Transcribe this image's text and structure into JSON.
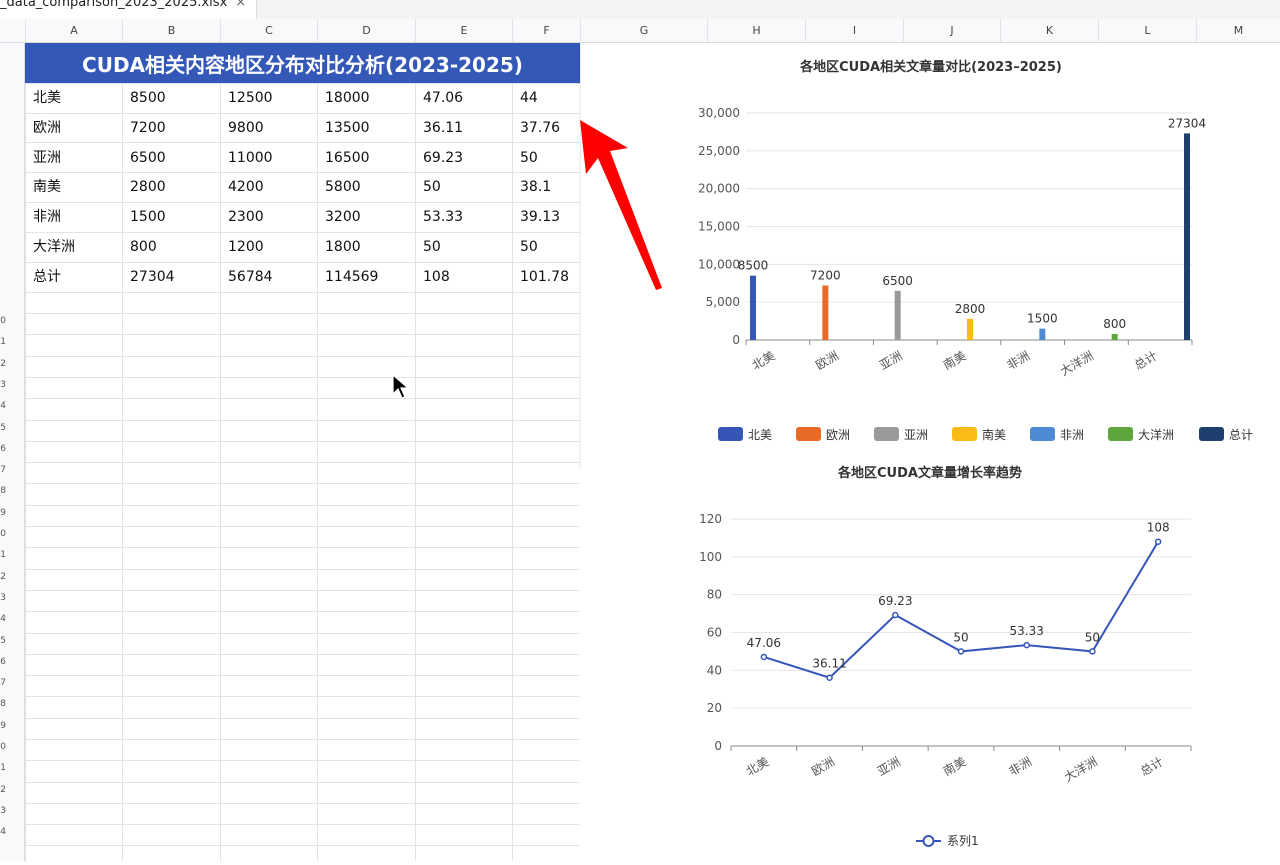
{
  "tab": {
    "title": "_data_comparison_2023_2025.xlsx",
    "close": "×"
  },
  "columns": [
    "A",
    "B",
    "C",
    "D",
    "E",
    "F",
    "G",
    "H",
    "I",
    "J",
    "K",
    "L",
    "M"
  ],
  "row_numbers": [
    "0",
    "1",
    "2",
    "3",
    "4",
    "5",
    "6",
    "7",
    "8",
    "9",
    "0",
    "1",
    "2",
    "3",
    "4",
    "5",
    "6",
    "7",
    "8",
    "9",
    "0",
    "1",
    "2",
    "3",
    "4"
  ],
  "sheet": {
    "title": "CUDA相关内容地区分布对比分析(2023-2025)",
    "rows": [
      [
        "北美",
        "8500",
        "12500",
        "18000",
        "47.06",
        "44"
      ],
      [
        "欧洲",
        "7200",
        "9800",
        "13500",
        "36.11",
        "37.76"
      ],
      [
        "亚洲",
        "6500",
        "11000",
        "16500",
        "69.23",
        "50"
      ],
      [
        "南美",
        "2800",
        "4200",
        "5800",
        "50",
        "38.1"
      ],
      [
        "非洲",
        "1500",
        "2300",
        "3200",
        "53.33",
        "39.13"
      ],
      [
        "大洋洲",
        "800",
        "1200",
        "1800",
        "50",
        "50"
      ],
      [
        "总计",
        "27304",
        "56784",
        "114569",
        "108",
        "101.78"
      ]
    ]
  },
  "colors": {
    "header_blue": "#3358b8",
    "arrow_red": "#ff0000"
  },
  "chart_data": [
    {
      "type": "bar",
      "title": "各地区CUDA相关文章量对比(2023–2025)",
      "categories": [
        "北美",
        "欧洲",
        "亚洲",
        "南美",
        "非洲",
        "大洋洲",
        "总计"
      ],
      "series": [
        {
          "name": "北美",
          "values": [
            8500,
            null,
            null,
            null,
            null,
            null,
            null
          ],
          "color": "#3556b8"
        },
        {
          "name": "欧洲",
          "values": [
            null,
            7200,
            null,
            null,
            null,
            null,
            null
          ],
          "color": "#e86a24"
        },
        {
          "name": "亚洲",
          "values": [
            null,
            null,
            6500,
            null,
            null,
            null,
            null
          ],
          "color": "#9a9a9a"
        },
        {
          "name": "南美",
          "values": [
            null,
            null,
            null,
            2800,
            null,
            null,
            null
          ],
          "color": "#fbbb16"
        },
        {
          "name": "非洲",
          "values": [
            null,
            null,
            null,
            null,
            1500,
            null,
            null
          ],
          "color": "#4d8ad3"
        },
        {
          "name": "大洋洲",
          "values": [
            null,
            null,
            null,
            null,
            null,
            800,
            null
          ],
          "color": "#5ea53c"
        },
        {
          "name": "总计",
          "values": [
            null,
            null,
            null,
            null,
            null,
            null,
            27304
          ],
          "color": "#1f3f6f"
        }
      ],
      "yticks": [
        "0",
        "5,000",
        "10,000",
        "15,000",
        "20,000",
        "25,000",
        "30,000"
      ],
      "ylim": [
        0,
        30000
      ],
      "legend": "bottom"
    },
    {
      "type": "line",
      "title": "各地区CUDA文章量增长率趋势",
      "categories": [
        "北美",
        "欧洲",
        "亚洲",
        "南美",
        "非洲",
        "大洋洲",
        "总计"
      ],
      "series": [
        {
          "name": "系列1",
          "values": [
            47.06,
            36.11,
            69.23,
            50,
            53.33,
            50,
            108
          ],
          "color": "#3556b8"
        }
      ],
      "yticks": [
        "0",
        "20",
        "40",
        "60",
        "80",
        "100",
        "120"
      ],
      "ylim": [
        0,
        120
      ],
      "legend": "bottom"
    }
  ]
}
